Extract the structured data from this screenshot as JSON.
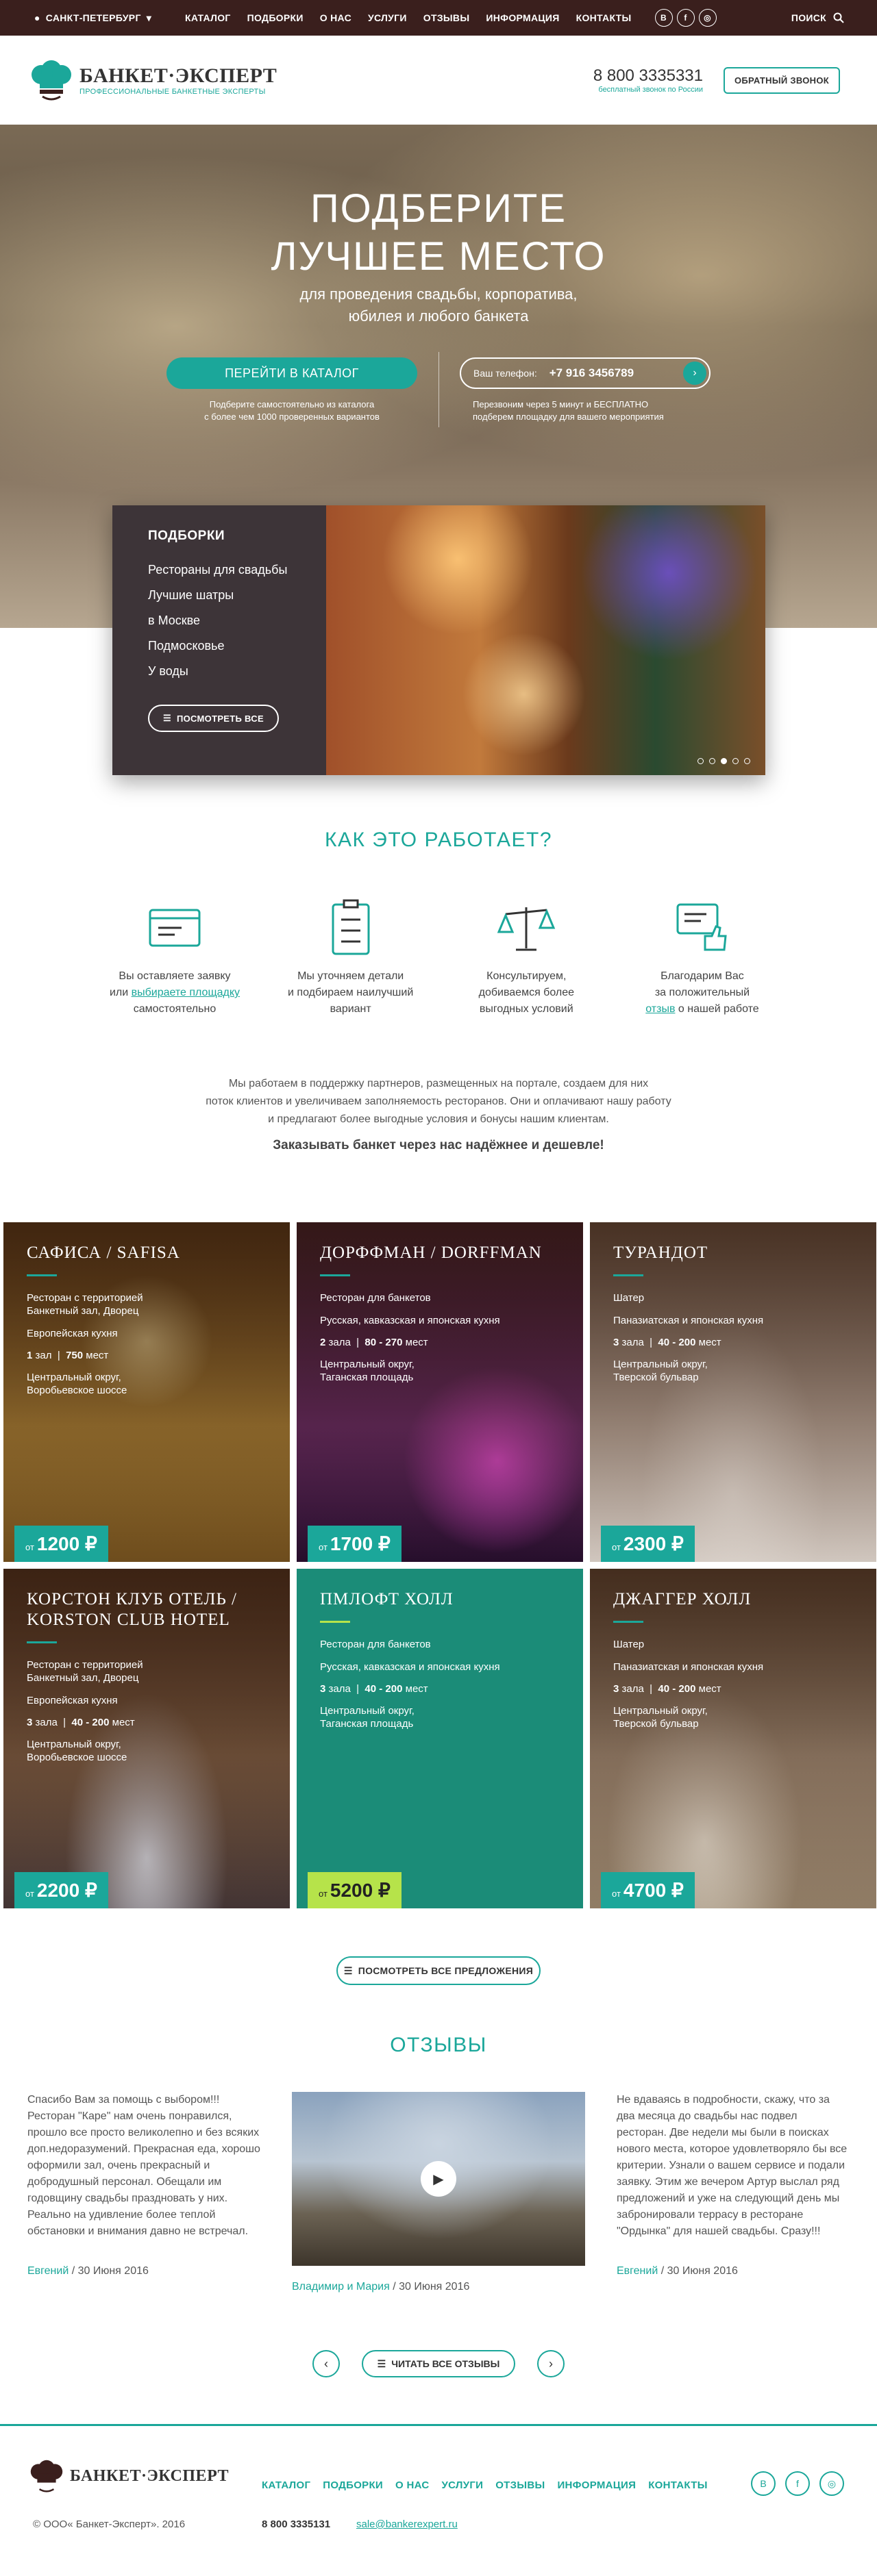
{
  "topbar": {
    "city": "САНКТ-ПЕТЕРБУРГ",
    "menu": [
      "КАТАЛОГ",
      "ПОДБОРКИ",
      "О НАС",
      "УСЛУГИ",
      "ОТЗЫВЫ",
      "ИНФОРМАЦИЯ",
      "КОНТАКТЫ"
    ],
    "social": [
      "B",
      "f",
      "◎"
    ],
    "search": "ПОИСК"
  },
  "header": {
    "logo_title": "БАНКЕТ·ЭКСПЕРТ",
    "logo_sub": "ПРОФЕССИОНАЛЬНЫЕ БАНКЕТНЫЕ ЭКСПЕРТЫ",
    "phone": "8 800 3335331",
    "phone_note": "бесплатный звонок по России",
    "callback": "ОБРАТНЫЙ ЗВОНОК"
  },
  "hero": {
    "title1": "ПОДБЕРИТЕ",
    "title2": "ЛУЧШЕЕ МЕСТО",
    "sub1": "для проведения свадьбы, корпоратива,",
    "sub2": "юбилея и любого банкета",
    "catalog_btn": "ПЕРЕЙТИ В КАТАЛОГ",
    "catalog_note1": "Подберите самостоятельно из каталога",
    "catalog_note2": "с более чем 1000 проверенных вариантов",
    "phone_label": "Ваш телефон:",
    "phone_value": "+7 916 3456789",
    "phone_note1": "Перезвоним через 5 минут и БЕСПЛАТНО",
    "phone_note2": "подберем площадку для вашего мероприятия"
  },
  "collections": {
    "heading": "ПОДБОРКИ",
    "items": [
      "Рестораны для свадьбы",
      "Лучшие шатры",
      "в Москве",
      "Подмосковье",
      "У воды"
    ],
    "btn": "ПОСМОТРЕТЬ ВСЕ"
  },
  "how": {
    "title": "КАК ЭТО РАБОТАЕТ?",
    "steps": [
      {
        "l1": "Вы оставляете заявку",
        "l2a": "или ",
        "l2b": "выбираете площадку",
        "l3": "самостоятельно"
      },
      {
        "l1": "Мы уточняем детали",
        "l2": "и подбираем наилучший",
        "l3": "вариант"
      },
      {
        "l1": "Консультируем,",
        "l2": "добиваемся более",
        "l3": "выгодных условий"
      },
      {
        "l1": "Благодарим Вас",
        "l2": "за положительный",
        "l3a": "отзыв",
        "l3b": " о нашей работе"
      }
    ],
    "about1": "Мы работаем в поддержку партнеров, размещенных на портале, создаем для них",
    "about2": "поток клиентов и увеличиваем заполняемость ресторанов. Они и оплачивают нашу работу",
    "about3": "и предлагают более выгодные условия и бонусы нашим клиентам.",
    "about_bold": "Заказывать банкет через нас надёжнее и дешевле!"
  },
  "venues": [
    {
      "name": "САФИСА / SAFISA",
      "type1": "Ресторан с территорией",
      "type2": "Банкетный зал, Дворец",
      "cuisine": "Европейская кухня",
      "halls": "1",
      "halls_word": "зал",
      "cap": "750",
      "cap_word": "мест",
      "loc1": "Центральный округ,",
      "loc2": "Воробьевское шоссе",
      "price_prefix": "от",
      "price": "1200 ₽"
    },
    {
      "name": "ДОРФФМАН / DORFFMAN",
      "type1": "Ресторан для банкетов",
      "type2": "",
      "cuisine": "Русская, кавказская и японская кухня",
      "halls": "2",
      "halls_word": "зала",
      "cap": "80 - 270",
      "cap_word": "мест",
      "loc1": "Центральный округ,",
      "loc2": "Таганская площадь",
      "price_prefix": "от",
      "price": "1700 ₽"
    },
    {
      "name": "ТУРАНДОТ",
      "type1": "Шатер",
      "type2": "",
      "cuisine": "Паназиатская и японская кухня",
      "halls": "3",
      "halls_word": "зала",
      "cap": "40 - 200",
      "cap_word": "мест",
      "loc1": "Центральный округ,",
      "loc2": "Тверской бульвар",
      "price_prefix": "от",
      "price": "2300 ₽"
    },
    {
      "name": "КОРСТОН КЛУБ ОТЕЛЬ / KORSTON CLUB HOTEL",
      "type1": "Ресторан с территорией",
      "type2": "Банкетный зал, Дворец",
      "cuisine": "Европейская кухня",
      "halls": "3",
      "halls_word": "зала",
      "cap": "40 - 200",
      "cap_word": "мест",
      "loc1": "Центральный округ,",
      "loc2": "Воробьевское шоссе",
      "price_prefix": "от",
      "price": "2200 ₽"
    },
    {
      "name": "ПМЛОФТ ХОЛЛ",
      "type1": "Ресторан для банкетов",
      "type2": "",
      "cuisine": "Русская, кавказская и японская кухня",
      "halls": "3",
      "halls_word": "зала",
      "cap": "40 - 200",
      "cap_word": "мест",
      "loc1": "Центральный округ,",
      "loc2": "Таганская площадь",
      "price_prefix": "от",
      "price": "5200 ₽"
    },
    {
      "name": "ДЖАГГЕР ХОЛЛ",
      "type1": "Шатер",
      "type2": "",
      "cuisine": "Паназиатская и японская кухня",
      "halls": "3",
      "halls_word": "зала",
      "cap": "40 - 200",
      "cap_word": "мест",
      "loc1": "Центральный округ,",
      "loc2": "Тверской бульвар",
      "price_prefix": "от",
      "price": "4700 ₽"
    }
  ],
  "all_offers_btn": "ПОСМОТРЕТЬ ВСЕ ПРЕДЛОЖЕНИЯ",
  "reviews": {
    "title": "ОТЗЫВЫ",
    "left_text": "Спасибо Вам за помощь с выбором!!! Ресторан \"Каре\" нам очень понравился, прошло все просто великолепно и без всяких доп.недоразумений. Прекрасная еда, хорошо оформили зал, очень прекрасный и добродушный персонал. Обещали им годовщину свадьбы праздновать у них. Реально на удивление более теплой обстановки и внимания давно не встречал.",
    "left_author": "Евгений",
    "left_date": " / 30 Июня 2016",
    "video_author": "Владимир и Мария",
    "video_date": " / 30 Июня 2016",
    "right_text": "Не вдаваясь в подробности, скажу, что за два месяца до свадьбы нас подвел ресторан. Две недели мы были в поисках нового места, которое удовлетворяло бы все критерии. Узнали о вашем сервисе и подали заявку. Этим же вечером Артур выслал ряд предложений и уже на следующий день мы забронировали террасу в ресторане \"Ордынка\" для нашей свадьбы. Сразу!!!",
    "right_author": "Евгений",
    "right_date": " / 30 Июня 2016",
    "read_all": "ЧИТАТЬ ВСЕ ОТЗЫВЫ"
  },
  "footer": {
    "logo_title": "БАНКЕТ·ЭКСПЕРТ",
    "menu": [
      "КАТАЛОГ",
      "ПОДБОРКИ",
      "О НАС",
      "УСЛУГИ",
      "ОТЗЫВЫ",
      "ИНФОРМАЦИЯ",
      "КОНТАКТЫ"
    ],
    "social": [
      "B",
      "f",
      "◎"
    ],
    "copy": "© ООО« Банкет-Эксперт». 2016",
    "phone": "8 800 3335131",
    "email": "sale@bankerexpert.ru"
  },
  "colors": {
    "accent": "#1ba79a",
    "dark": "#3a1f1d",
    "lime": "#b6e34a"
  }
}
